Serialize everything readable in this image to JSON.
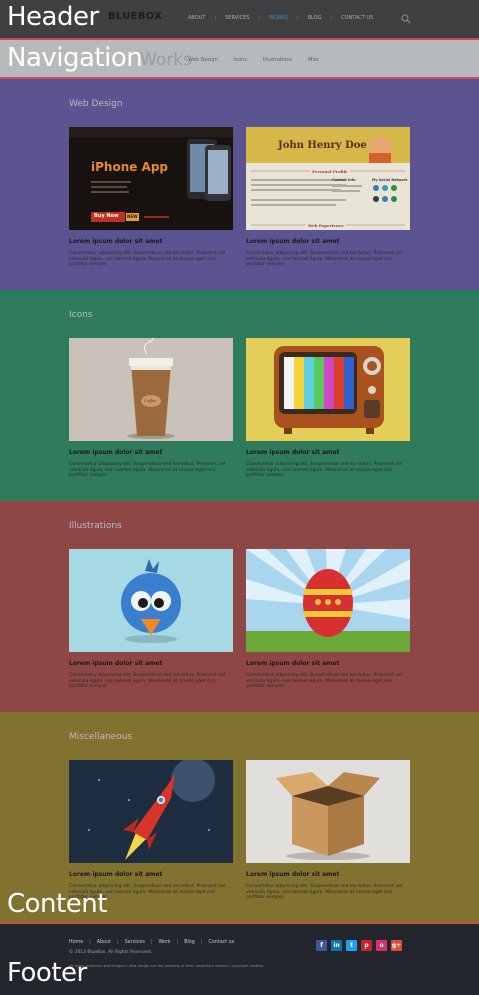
{
  "header": {
    "logo": "BLUEBOX",
    "nav": [
      "ABOUT",
      "SERVICES",
      "WORKS",
      "BLOG",
      "CONTACT US"
    ],
    "active_nav": "WORKS"
  },
  "subnav": {
    "title": "Works",
    "links": [
      "Web Design",
      "Icons",
      "Illustrations",
      "Misc"
    ]
  },
  "sections": [
    {
      "title": "Web Design",
      "color": "#5b5490"
    },
    {
      "title": "Icons",
      "color": "#2e7c5c"
    },
    {
      "title": "Illustrations",
      "color": "#8f4745"
    },
    {
      "title": "Miscellaneous",
      "color": "#81732f"
    }
  ],
  "card": {
    "title": "Lorem ipsum dolor sit amet",
    "text": "Consectetur adipiscing elit. Suspendisse sed leo tellus. Praesent vel vehicula ligula, non laoreet ligula. Maecenas at massa eget orci porttitor semper."
  },
  "thumbs": {
    "iphone": {
      "heading": "iPhone App",
      "button": "Buy Now",
      "badge": "NEW"
    },
    "resume": {
      "name": "John Henry Doe",
      "profile": "Personal Profile",
      "experience": "Web Experience",
      "contact": "Contact Info",
      "social": "My Social Network"
    },
    "coffee": {
      "label": "Coffee"
    }
  },
  "overlay_labels": {
    "header": "Header",
    "navigation": "Navigation",
    "content": "Content",
    "footer": "Footer"
  },
  "footer": {
    "links": [
      "Home",
      "About",
      "Services",
      "Work",
      "Blog",
      "Contact us"
    ],
    "copyright": "© 2013 BlueBox. All Rights Reserved.",
    "disclaimer": "All logos, artworks and images in this design are the property of their respective owners / copyright holders.",
    "social": [
      "f",
      "in",
      "t",
      "p",
      "o",
      "g+"
    ],
    "social_colors": [
      "#3b5998",
      "#0e76a8",
      "#1da1f2",
      "#c8232c",
      "#d6336c",
      "#dd4b39"
    ]
  }
}
